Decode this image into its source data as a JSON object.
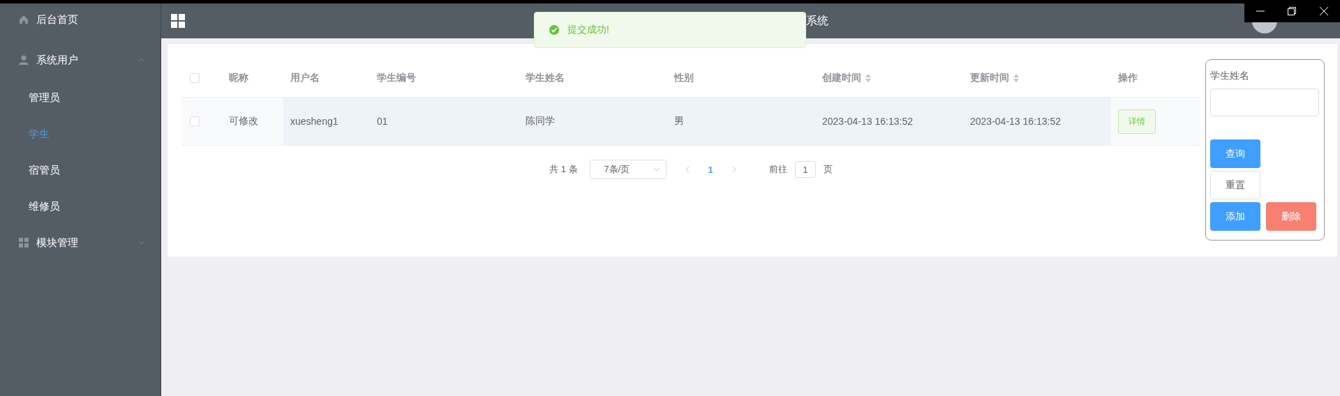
{
  "sidebar": {
    "items": [
      {
        "label": "后台首页",
        "kind": "link"
      },
      {
        "label": "系统用户",
        "kind": "group",
        "expanded": true,
        "children": [
          {
            "label": "管理员",
            "selected": false
          },
          {
            "label": "学生",
            "selected": true
          },
          {
            "label": "宿管员",
            "selected": false
          },
          {
            "label": "维修员",
            "selected": false
          }
        ]
      },
      {
        "label": "模块管理",
        "kind": "group",
        "expanded": false
      }
    ]
  },
  "header": {
    "title": "系统"
  },
  "toast": {
    "message": "提交成功!"
  },
  "table": {
    "header_checked": false,
    "columns": [
      {
        "label": "昵称",
        "sortable": false
      },
      {
        "label": "用户名",
        "sortable": false
      },
      {
        "label": "学生编号",
        "sortable": false
      },
      {
        "label": "学生姓名",
        "sortable": false
      },
      {
        "label": "性别",
        "sortable": false
      },
      {
        "label": "创建时间",
        "sortable": true
      },
      {
        "label": "更新时间",
        "sortable": true
      },
      {
        "label": "操作",
        "sortable": false
      }
    ],
    "rows": [
      {
        "checked": false,
        "hovered": true,
        "cells": [
          "可修改",
          "xuesheng1",
          "01",
          "陈同学",
          "男",
          "2023-04-13 16:13:52",
          "2023-04-13 16:13:52"
        ],
        "action": "详情"
      }
    ]
  },
  "pagination": {
    "total": "共 1 条",
    "page_size": "7条/页",
    "pages": [
      {
        "label": "1",
        "selected": true
      }
    ],
    "goto_label": "前往",
    "goto_value": "1",
    "goto_suffix": "页"
  },
  "search_panel": {
    "label": "学生姓名",
    "buttons": [
      {
        "label": "查询",
        "kind": "primary"
      },
      {
        "label": "重置",
        "kind": "default"
      },
      {
        "label": "添加",
        "kind": "primary"
      },
      {
        "label": "删除",
        "kind": "danger"
      }
    ]
  }
}
